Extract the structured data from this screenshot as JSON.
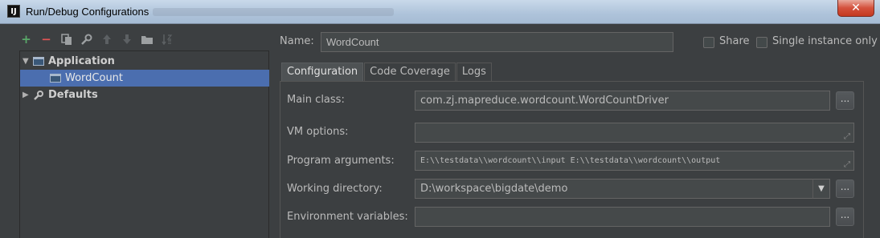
{
  "window": {
    "title": "Run/Debug Configurations",
    "app_icon_text": "IJ",
    "close_symbol": "✕"
  },
  "toolbar": {
    "icons": [
      "add-icon",
      "remove-icon",
      "copy-icon",
      "edit-defaults-icon",
      "move-up-icon",
      "move-down-icon",
      "folder-icon",
      "sort-icon"
    ],
    "add_symbol": "+",
    "remove_symbol": "−"
  },
  "tree": {
    "application": "Application",
    "wordcount": "WordCount",
    "defaults": "Defaults"
  },
  "name": {
    "label": "Name:",
    "value": "WordCount"
  },
  "share_label": "Share",
  "single_instance_label": "Single instance only",
  "tabs": [
    {
      "label": "Configuration",
      "active": true
    },
    {
      "label": "Code Coverage",
      "active": false
    },
    {
      "label": "Logs",
      "active": false
    }
  ],
  "config": {
    "main_class_label": "Main class:",
    "main_class_value": "com.zj.mapreduce.wordcount.WordCountDriver",
    "vm_options_label": "VM options:",
    "vm_options_value": "",
    "program_args_label": "Program arguments:",
    "program_args_value": "E:\\\\testdata\\\\wordcount\\\\input E:\\\\testdata\\\\wordcount\\\\output",
    "working_dir_label": "Working directory:",
    "working_dir_value": "D:\\workspace\\bigdate\\demo",
    "env_vars_label": "Environment variables:",
    "env_vars_value": "",
    "browse_label": "..."
  },
  "colors": {
    "background": "#3c3f41",
    "selection": "#4b6eaf",
    "add_green": "#59a869",
    "remove_red": "#e05555"
  }
}
